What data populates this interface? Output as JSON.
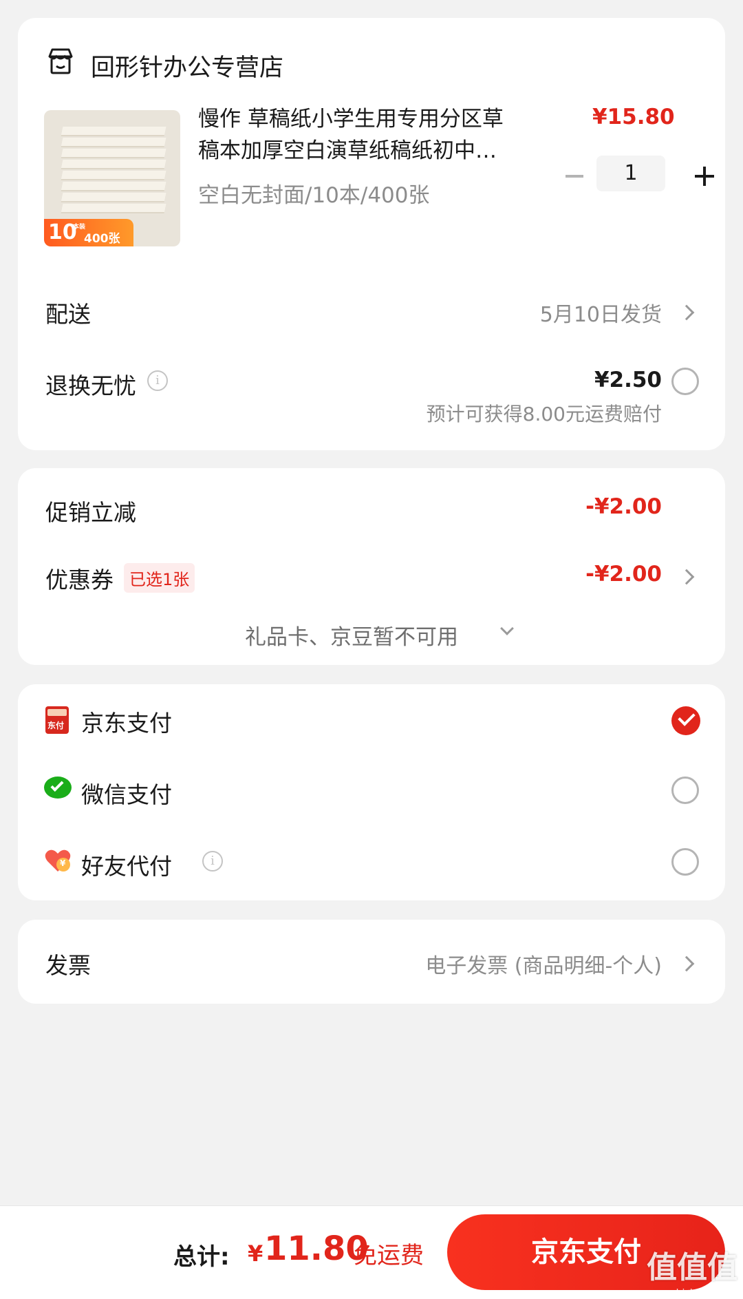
{
  "store": {
    "name": "回形针办公专营店",
    "icon": "store-icon"
  },
  "product": {
    "title_line1": "慢作 草稿纸小学生用专用分区草",
    "title_line2": "稿本加厚空白演草纸稿纸初中…",
    "spec": "空白无封面/10本/400张",
    "price": "¥15.80",
    "quantity": "1",
    "image_badge_count": "10",
    "image_badge_unit": "本装",
    "image_badge_sheets": "400张"
  },
  "delivery": {
    "label": "配送",
    "value": "5月10日发货"
  },
  "return_worry_free": {
    "label": "退换无忧",
    "price": "¥2.50",
    "note": "预计可获得8.00元运费赔付"
  },
  "discounts": {
    "promo_label": "促销立减",
    "promo_value": "-¥2.00",
    "coupon_label": "优惠券",
    "coupon_tag": "已选1张",
    "coupon_value": "-¥2.00",
    "giftcard_text": "礼品卡、京豆暂不可用"
  },
  "payment_methods": [
    {
      "label": "京东支付",
      "icon": "jd-pay-icon",
      "selected": true,
      "icon_text": "东付"
    },
    {
      "label": "微信支付",
      "icon": "wechat-pay-icon",
      "selected": false
    },
    {
      "label": "好友代付",
      "icon": "friend-pay-icon",
      "selected": false,
      "icon_text": "¥"
    }
  ],
  "invoice": {
    "label": "发票",
    "value": "电子发票 (商品明细-个人)"
  },
  "bottom": {
    "total_label": "总计:",
    "currency": "¥",
    "total_amount": "11.80",
    "free_shipping": "免运费",
    "pay_button": "京东支付",
    "watermark": "值值值",
    "watermark_url": "zhizhizhi.com"
  },
  "colors": {
    "accent_red": "#e1251b",
    "wechat_green": "#1aad19",
    "background": "#f2f2f2"
  }
}
